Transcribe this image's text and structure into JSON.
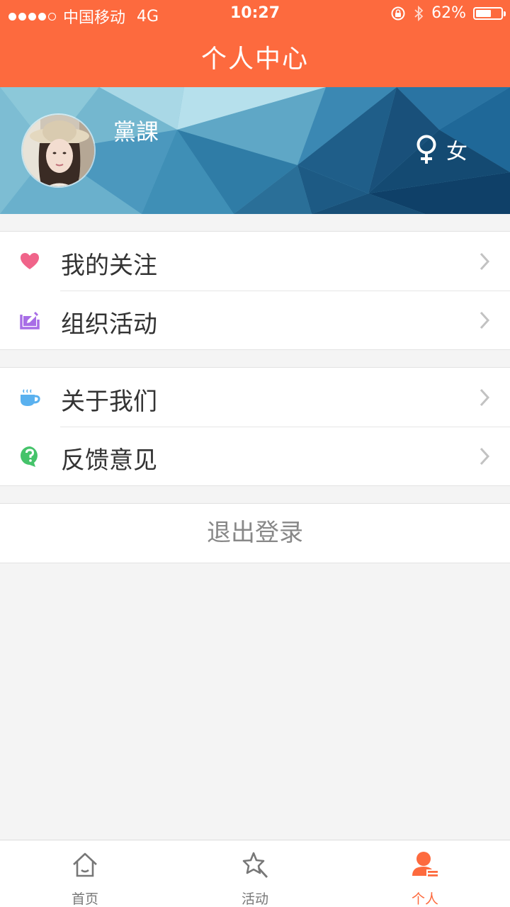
{
  "status_bar": {
    "carrier": "中国移动",
    "network": "4G",
    "time": "10:27",
    "battery_text": "62%",
    "battery_level": 0.62,
    "signal_bars": 4
  },
  "header": {
    "title": "个人中心"
  },
  "profile": {
    "name": "黨課",
    "gender_label": "女"
  },
  "menu_group_1": [
    {
      "label": "我的关注",
      "icon": "heart-icon",
      "color": "#f0648a"
    },
    {
      "label": "组织活动",
      "icon": "edit-icon",
      "color": "#a86ee6"
    }
  ],
  "menu_group_2": [
    {
      "label": "关于我们",
      "icon": "coffee-cup-icon",
      "color": "#5ab1ef"
    },
    {
      "label": "反馈意见",
      "icon": "question-bubble-icon",
      "color": "#45c36a"
    }
  ],
  "logout_label": "退出登录",
  "tabbar": {
    "items": [
      {
        "label": "首页",
        "icon": "home-icon"
      },
      {
        "label": "活动",
        "icon": "star-activity-icon"
      },
      {
        "label": "个人",
        "icon": "person-icon",
        "active": true
      }
    ]
  },
  "colors": {
    "brand": "#fd6a3e",
    "background": "#f4f4f4"
  }
}
